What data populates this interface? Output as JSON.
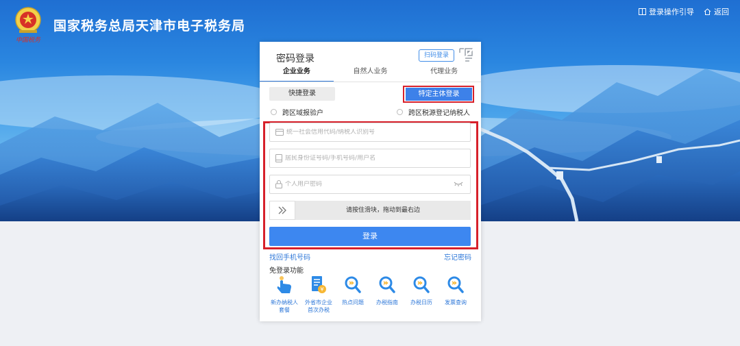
{
  "header": {
    "site_title": "国家税务总局天津市电子税务局",
    "logo_caption": "中国税务",
    "login_guide": "登录操作引导",
    "back": "返回"
  },
  "login": {
    "title": "密码登录",
    "qr_button": "扫码登录",
    "tabs": [
      {
        "label": "企业业务",
        "active": true
      },
      {
        "label": "自然人业务",
        "active": false
      },
      {
        "label": "代理业务",
        "active": false
      }
    ],
    "quick_login": "快捷登录",
    "special_login": "特定主体登录",
    "radio_left": "跨区域报验户",
    "radio_right": "跨区税源登记纳税人",
    "credit_code_placeholder": "统一社会信用代码/纳税人识别号",
    "account_placeholder": "居民身份证号码/手机号码/用户名",
    "password_placeholder": "个人用户密码",
    "slider_text": "请按住滑块，拖动到最右边",
    "login_button": "登录",
    "recover_phone": "找回手机号码",
    "forgot_password": "忘记密码",
    "free_title": "免登录功能",
    "shortcuts": [
      {
        "line1": "新办纳税人",
        "line2": "套餐",
        "icon": "hand-pointer-icon"
      },
      {
        "line1": "外省市企业",
        "line2": "首次办税",
        "icon": "document-yen-icon"
      },
      {
        "line1": "热点问题",
        "line2": "",
        "icon": "search-icon"
      },
      {
        "line1": "办税指南",
        "line2": "",
        "icon": "search-icon"
      },
      {
        "line1": "办税日历",
        "line2": "",
        "icon": "search-icon"
      },
      {
        "line1": "发票查询",
        "line2": "",
        "icon": "search-icon"
      }
    ]
  },
  "colors": {
    "accent": "#3d87f0",
    "highlight_border": "#d7202a",
    "link": "#2d77d8"
  }
}
